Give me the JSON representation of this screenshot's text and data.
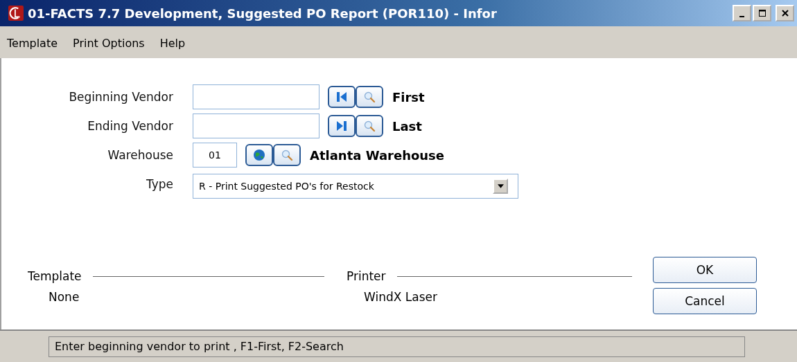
{
  "window": {
    "title": "01-FACTS 7.7 Development, Suggested PO Report (POR110) - Infor"
  },
  "menu": [
    "Template",
    "Print Options",
    "Help"
  ],
  "fields": [
    {
      "label": "Beginning Vendor",
      "kind": "text",
      "tools": [
        {
          "kind": "first"
        },
        {
          "kind": "search"
        }
      ],
      "note": "First"
    },
    {
      "label": "Ending Vendor",
      "kind": "text",
      "tools": [
        {
          "kind": "last"
        },
        {
          "kind": "search"
        }
      ],
      "note": "Last"
    },
    {
      "label": "Warehouse",
      "kind": "code",
      "value": "01",
      "tools": [
        {
          "kind": "all"
        },
        {
          "kind": "search"
        }
      ],
      "note": "Atlanta Warehouse"
    },
    {
      "label": "Type",
      "kind": "select",
      "value": "R - Print Suggested PO's for Restock"
    }
  ],
  "template": {
    "label": "Template",
    "value": "None"
  },
  "printer": {
    "label": "Printer",
    "value": "WindX Laser"
  },
  "buttons": [
    "OK",
    "Cancel"
  ],
  "status_bar": "Enter beginning vendor to print , F1-First, F2-Search"
}
